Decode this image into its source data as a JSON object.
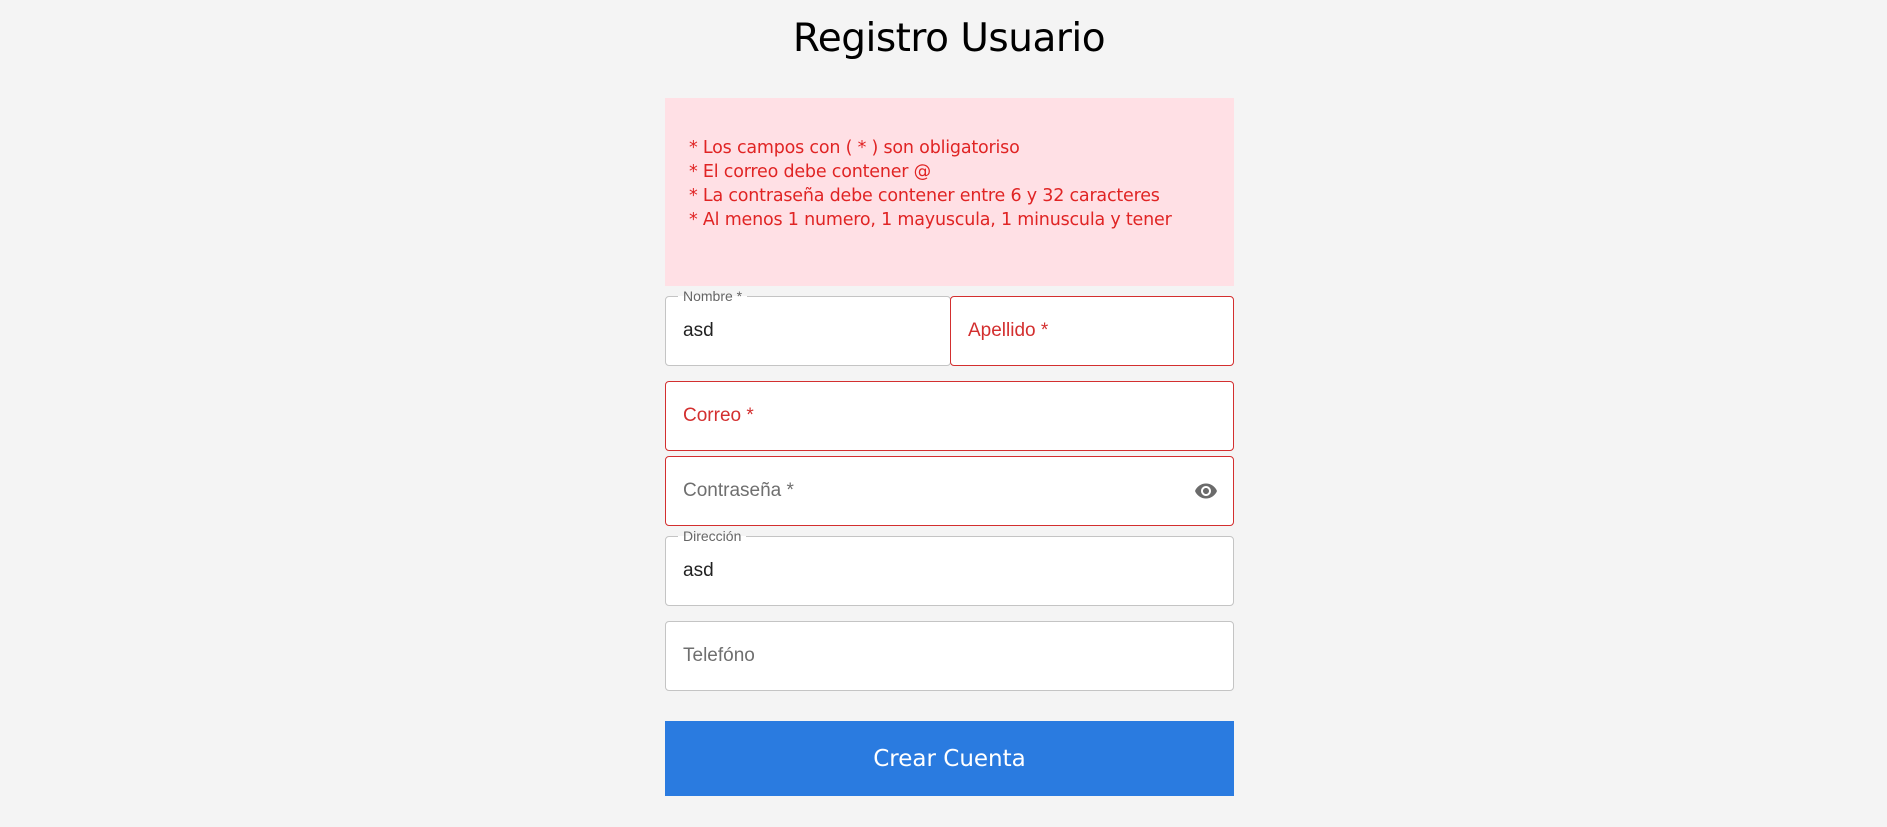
{
  "header": {
    "title": "Registro Usuario"
  },
  "alert": {
    "lines": [
      "* Los campos con ( * ) son obligatoriso",
      "* El correo debe contener @",
      "* La contraseña debe contener entre 6 y 32 caracteres",
      "* Al menos 1 numero, 1 mayuscula, 1 minuscula y tener"
    ],
    "color": "#e02424",
    "background": "#ffe0e5"
  },
  "form": {
    "nombre": {
      "label": "Nombre *",
      "value": "asd"
    },
    "apellido": {
      "label": "Apellido *",
      "value": ""
    },
    "correo": {
      "label": "Correo *",
      "value": ""
    },
    "contrasena": {
      "label": "Contraseña *",
      "value": "",
      "toggle_icon": "eye-icon"
    },
    "direccion": {
      "label": "Dirección",
      "value": "asd"
    },
    "telefono": {
      "label": "Telefóno",
      "value": ""
    },
    "submit_label": "Crear Cuenta"
  },
  "colors": {
    "accent": "#2a7be0",
    "error": "#d32f2f",
    "background": "#f4f4f4"
  }
}
